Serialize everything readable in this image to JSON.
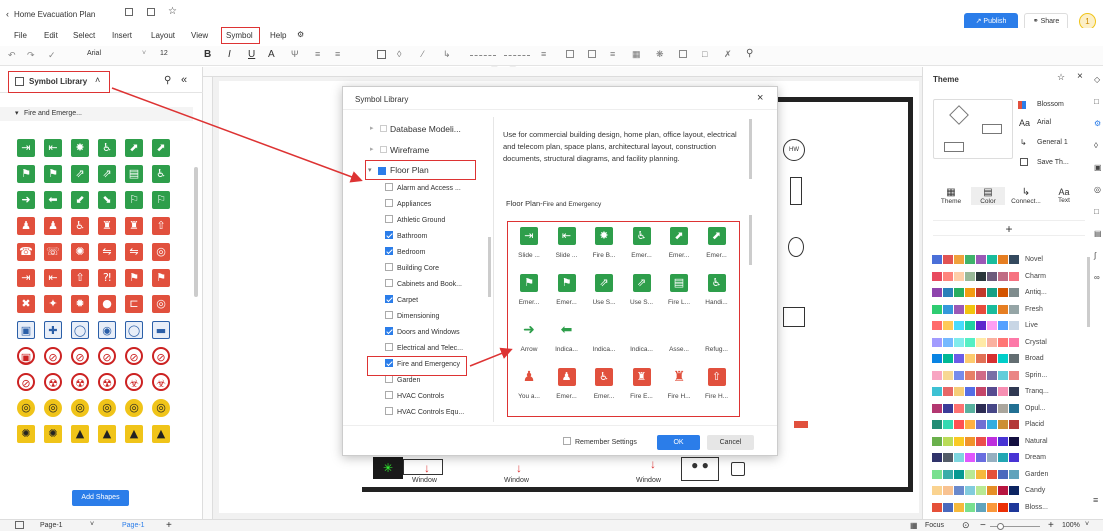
{
  "window": {
    "doc_title": "Home Evacuation Plan",
    "user_initial": "1"
  },
  "header": {
    "publish": "Publish",
    "share": "Share"
  },
  "menu": [
    "File",
    "Edit",
    "Select",
    "Insert",
    "Layout",
    "View",
    "Symbol",
    "Help"
  ],
  "toolbar": {
    "font": "Arial",
    "size": "12"
  },
  "left": {
    "title": "Symbol Library",
    "category": "Fire and Emerge...",
    "add_shapes": "Add Shapes"
  },
  "dialog": {
    "title": "Symbol Library",
    "tree": {
      "db": "Database Modeli...",
      "wire": "Wireframe",
      "floor": "Floor Plan"
    },
    "items": [
      {
        "label": "Alarm and Access ...",
        "checked": false
      },
      {
        "label": "Appliances",
        "checked": false
      },
      {
        "label": "Athletic Ground",
        "checked": false
      },
      {
        "label": "Bathroom",
        "checked": true
      },
      {
        "label": "Bedroom",
        "checked": true
      },
      {
        "label": "Building Core",
        "checked": false
      },
      {
        "label": "Cabinets and Book...",
        "checked": false
      },
      {
        "label": "Carpet",
        "checked": true
      },
      {
        "label": "Dimensioning",
        "checked": false
      },
      {
        "label": "Doors and Windows",
        "checked": true
      },
      {
        "label": "Electrical and Telec...",
        "checked": false
      },
      {
        "label": "Fire and Emergency",
        "checked": true
      },
      {
        "label": "Garden",
        "checked": false
      },
      {
        "label": "HVAC Controls",
        "checked": false
      },
      {
        "label": "HVAC Controls Equ...",
        "checked": false
      }
    ],
    "description": "Use for commercial building design, home plan, office layout, electrical and telecom plan, space plans, architectural layout, construction documents, structural diagrams, and facility planning.",
    "section": "Floor Plan-",
    "section_sub": "Fire and Emergency",
    "symbols": [
      "Slide ...",
      "Slide ...",
      "Fire B...",
      "Emer...",
      "Emer...",
      "Emer...",
      "Emer...",
      "Emer...",
      "Use S...",
      "Use S...",
      "Fire L...",
      "Handi...",
      "Arrow",
      "Indica...",
      "Indica...",
      "Indica...",
      "Asse...",
      "Refug...",
      "You a...",
      "Emer...",
      "Emer...",
      "Fire E...",
      "Fire H...",
      "Fire H..."
    ],
    "remember": "Remember Settings",
    "ok": "OK",
    "cancel": "Cancel"
  },
  "canvas": {
    "windows": [
      "Window",
      "Window",
      "Window"
    ],
    "hw": "HW"
  },
  "theme": {
    "title": "Theme",
    "preview": [
      "Blossom",
      "Arial",
      "General 1",
      "Save Th..."
    ],
    "tabs": [
      "Theme",
      "Color",
      "Connect...",
      "Text"
    ],
    "names": [
      "Novel",
      "Charm",
      "Antiq...",
      "Fresh",
      "Live",
      "Crystal",
      "Broad",
      "Sprin...",
      "Tranq...",
      "Opul...",
      "Placid",
      "Natural",
      "Dream",
      "Garden",
      "Candy",
      "Bloss..."
    ]
  },
  "status": {
    "page_sel": "Page-1",
    "page_tab": "Page-1",
    "focus": "Focus",
    "zoom": "100%"
  },
  "colors": {
    "accent": "#2b7de9",
    "red": "#e1503d",
    "green": "#2e9e4b",
    "callout": "#d33"
  }
}
